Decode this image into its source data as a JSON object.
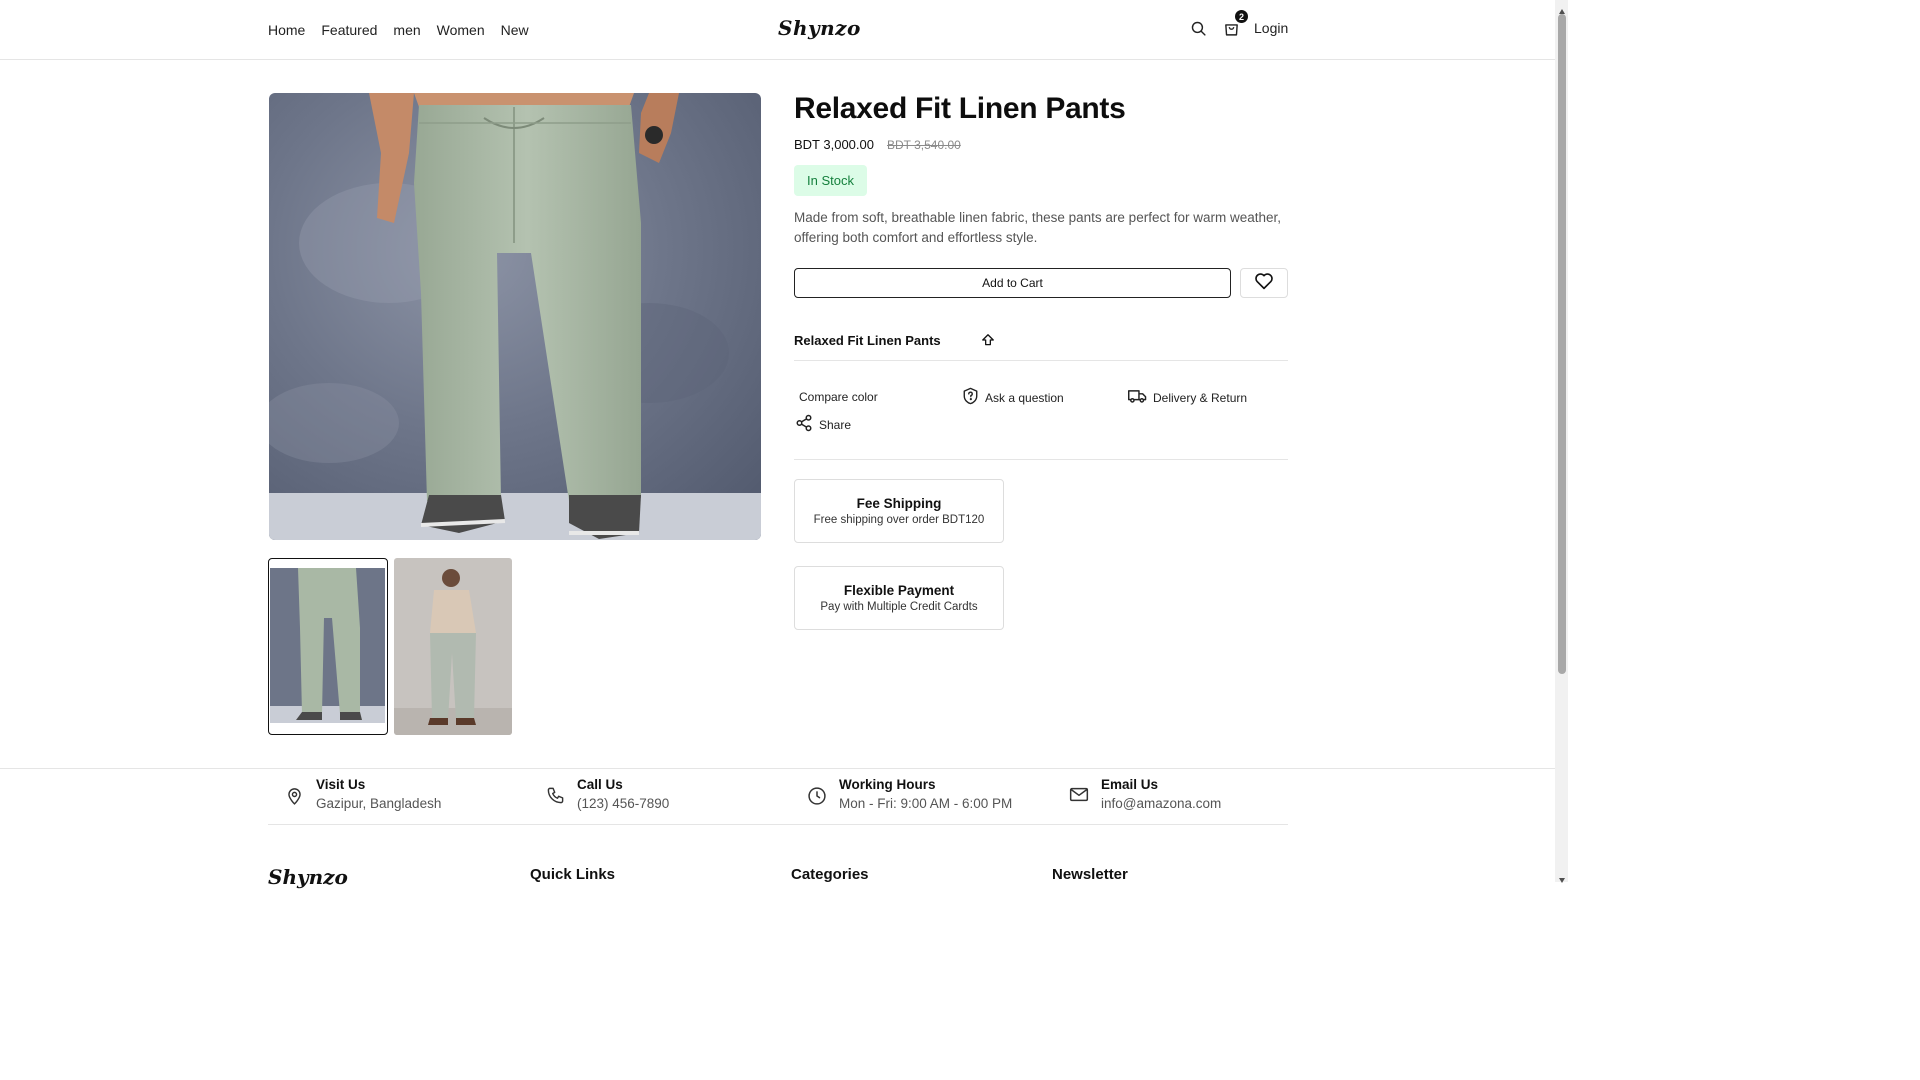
{
  "nav": {
    "items": [
      {
        "label": "Home"
      },
      {
        "label": "Featured"
      },
      {
        "label": "men"
      },
      {
        "label": "Women"
      },
      {
        "label": "New"
      }
    ],
    "logo": "Shynzo",
    "cart_count": "2",
    "login_label": "Login"
  },
  "product": {
    "title": "Relaxed Fit Linen Pants",
    "price": "BDT 3,000.00",
    "old_price": "BDT 3,540.00",
    "stock": "In Stock",
    "description": "Made from soft, breathable linen fabric, these pants are perfect for warm weather, offering both comfort and effortless style.",
    "add_to_cart": "Add to Cart",
    "variant_name": "Relaxed Fit Linen Pants",
    "actions": {
      "compare": "Compare color",
      "ask": "Ask a question",
      "delivery": "Delivery & Return",
      "share": "Share"
    },
    "features": [
      {
        "title": "Fee Shipping",
        "desc": "Free shipping over order BDT120"
      },
      {
        "title": "Flexible Payment",
        "desc": "Pay with Multiple Credit Cardts"
      }
    ]
  },
  "info": [
    {
      "title": "Visit Us",
      "value": "Gazipur, Bangladesh"
    },
    {
      "title": "Call Us",
      "value": "(123) 456-7890"
    },
    {
      "title": "Working Hours",
      "value": "Mon - Fri: 9:00 AM - 6:00 PM"
    },
    {
      "title": "Email Us",
      "value": "info@amazona.com"
    }
  ],
  "footer": {
    "logo": "Shynzo",
    "headings": [
      "Quick Links",
      "Categories",
      "Newsletter"
    ]
  },
  "colors": {
    "stock_bg": "#dcfce7",
    "stock_text": "#15803d",
    "pants": "#a9b8a5",
    "backdrop": "#6b7489"
  }
}
